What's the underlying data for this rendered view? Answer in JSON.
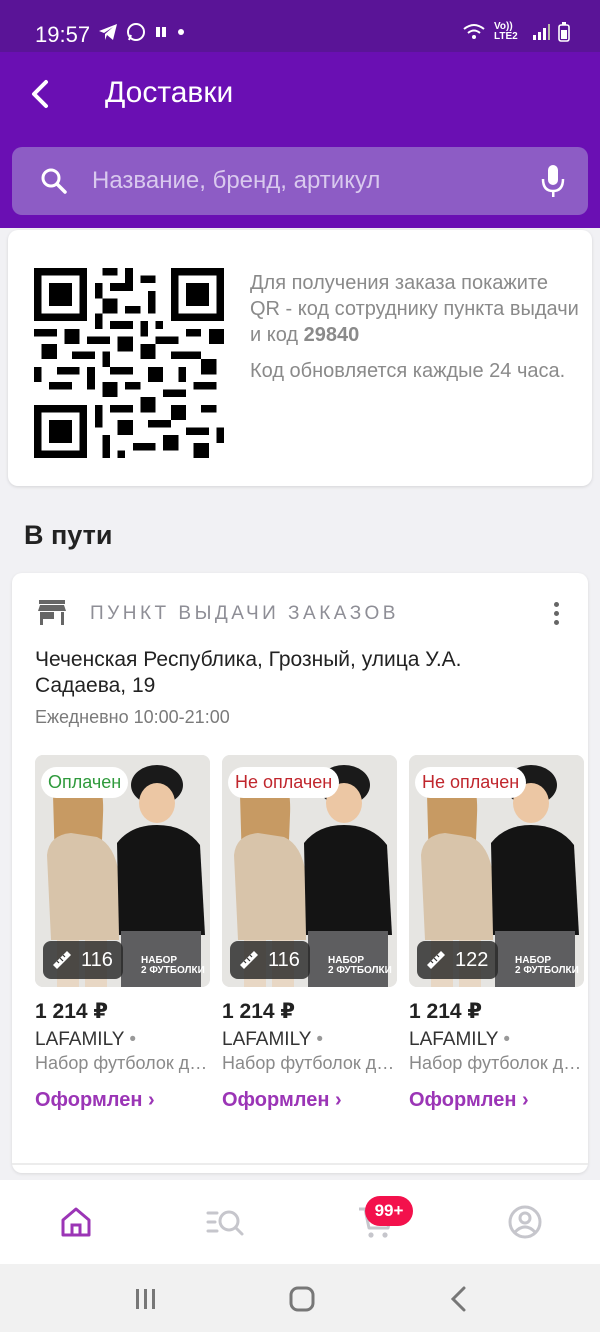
{
  "status_bar": {
    "time": "19:57",
    "network_label": "Vo)) LTE2"
  },
  "header": {
    "title": "Доставки"
  },
  "search": {
    "placeholder": "Название, бренд, артикул"
  },
  "qr_card": {
    "text_before_code": "Для получения заказа покажите QR - код сотруднику пункта выдачи и код ",
    "code": "29840",
    "refresh_note": "Код обновляется каждые 24 часа."
  },
  "section_title": "В пути",
  "delivery": {
    "pickup_label": "ПУНКТ ВЫДАЧИ ЗАКАЗОВ",
    "address": "Чеченская Республика, Грозный, улица У.А. Садаева, 19",
    "hours": "Ежедневно 10:00-21:00",
    "products": [
      {
        "badge": "Оплачен",
        "badge_type": "paid",
        "size": "116",
        "set_label_1": "НАБОР",
        "set_label_2": "2 ФУТБОЛКИ",
        "price": "1 214 ₽",
        "brand": "LAFAMILY",
        "brand_sep": "•",
        "name": "Набор футболок детских",
        "status": "Оформлен ›"
      },
      {
        "badge": "Не оплачен",
        "badge_type": "unpaid",
        "size": "116",
        "set_label_1": "НАБОР",
        "set_label_2": "2 ФУТБОЛКИ",
        "price": "1 214 ₽",
        "brand": "LAFAMILY",
        "brand_sep": "•",
        "name": "Набор футболок детских",
        "status": "Оформлен ›"
      },
      {
        "badge": "Не оплачен",
        "badge_type": "unpaid",
        "size": "122",
        "set_label_1": "НАБОР",
        "set_label_2": "2 ФУТБОЛКИ",
        "price": "1 214 ₽",
        "brand": "LAFAMILY",
        "brand_sep": "•",
        "name": "Набор футболок детских",
        "status": "Оформлен ›"
      }
    ]
  },
  "bottom_nav": {
    "cart_badge": "99+",
    "items": [
      "home-icon",
      "catalog-icon",
      "cart-icon",
      "profile-icon"
    ]
  },
  "colors": {
    "header": "#6a0fb3",
    "status_bar": "#5a1497",
    "accent": "#9b35b6",
    "paid": "#2f9a3c",
    "unpaid": "#c0262d",
    "cart_badge": "#f3114c"
  }
}
